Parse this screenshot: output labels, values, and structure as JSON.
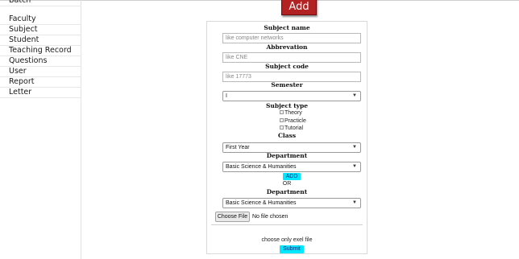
{
  "sidebar": {
    "items": [
      {
        "label": "Batch"
      },
      {
        "label": "Faculty"
      },
      {
        "label": "Subject"
      },
      {
        "label": "Student"
      },
      {
        "label": "Teaching Record"
      },
      {
        "label": "Questions"
      },
      {
        "label": "User"
      },
      {
        "label": "Report"
      },
      {
        "label": "Letter"
      }
    ]
  },
  "header": {
    "add_button_label": "Add",
    "add_button_color": "#b32222"
  },
  "form": {
    "subject_name": {
      "label": "Subject name",
      "placeholder": "like computer networks"
    },
    "abbreviation": {
      "label": "Abbrevation",
      "placeholder": "like CNE"
    },
    "subject_code": {
      "label": "Subject code",
      "placeholder": "like 17773"
    },
    "semester": {
      "label": "Semester",
      "value": "I"
    },
    "subject_type": {
      "label": "Subject type",
      "options": [
        "Theory",
        "Practicle",
        "Tutorial"
      ]
    },
    "class": {
      "label": "Class",
      "value": "First Year"
    },
    "department": {
      "label": "Department",
      "value": "Basic Science & Humanities"
    },
    "add_label": "ADD",
    "or_label": "OR",
    "department2": {
      "label": "Department",
      "value": "Basic Science & Humanities"
    },
    "file": {
      "button_label": "Choose File",
      "status": "No file chosen"
    },
    "note": "choose only exel file",
    "submit_label": "Submit",
    "accent_color": "#00e8ff"
  }
}
